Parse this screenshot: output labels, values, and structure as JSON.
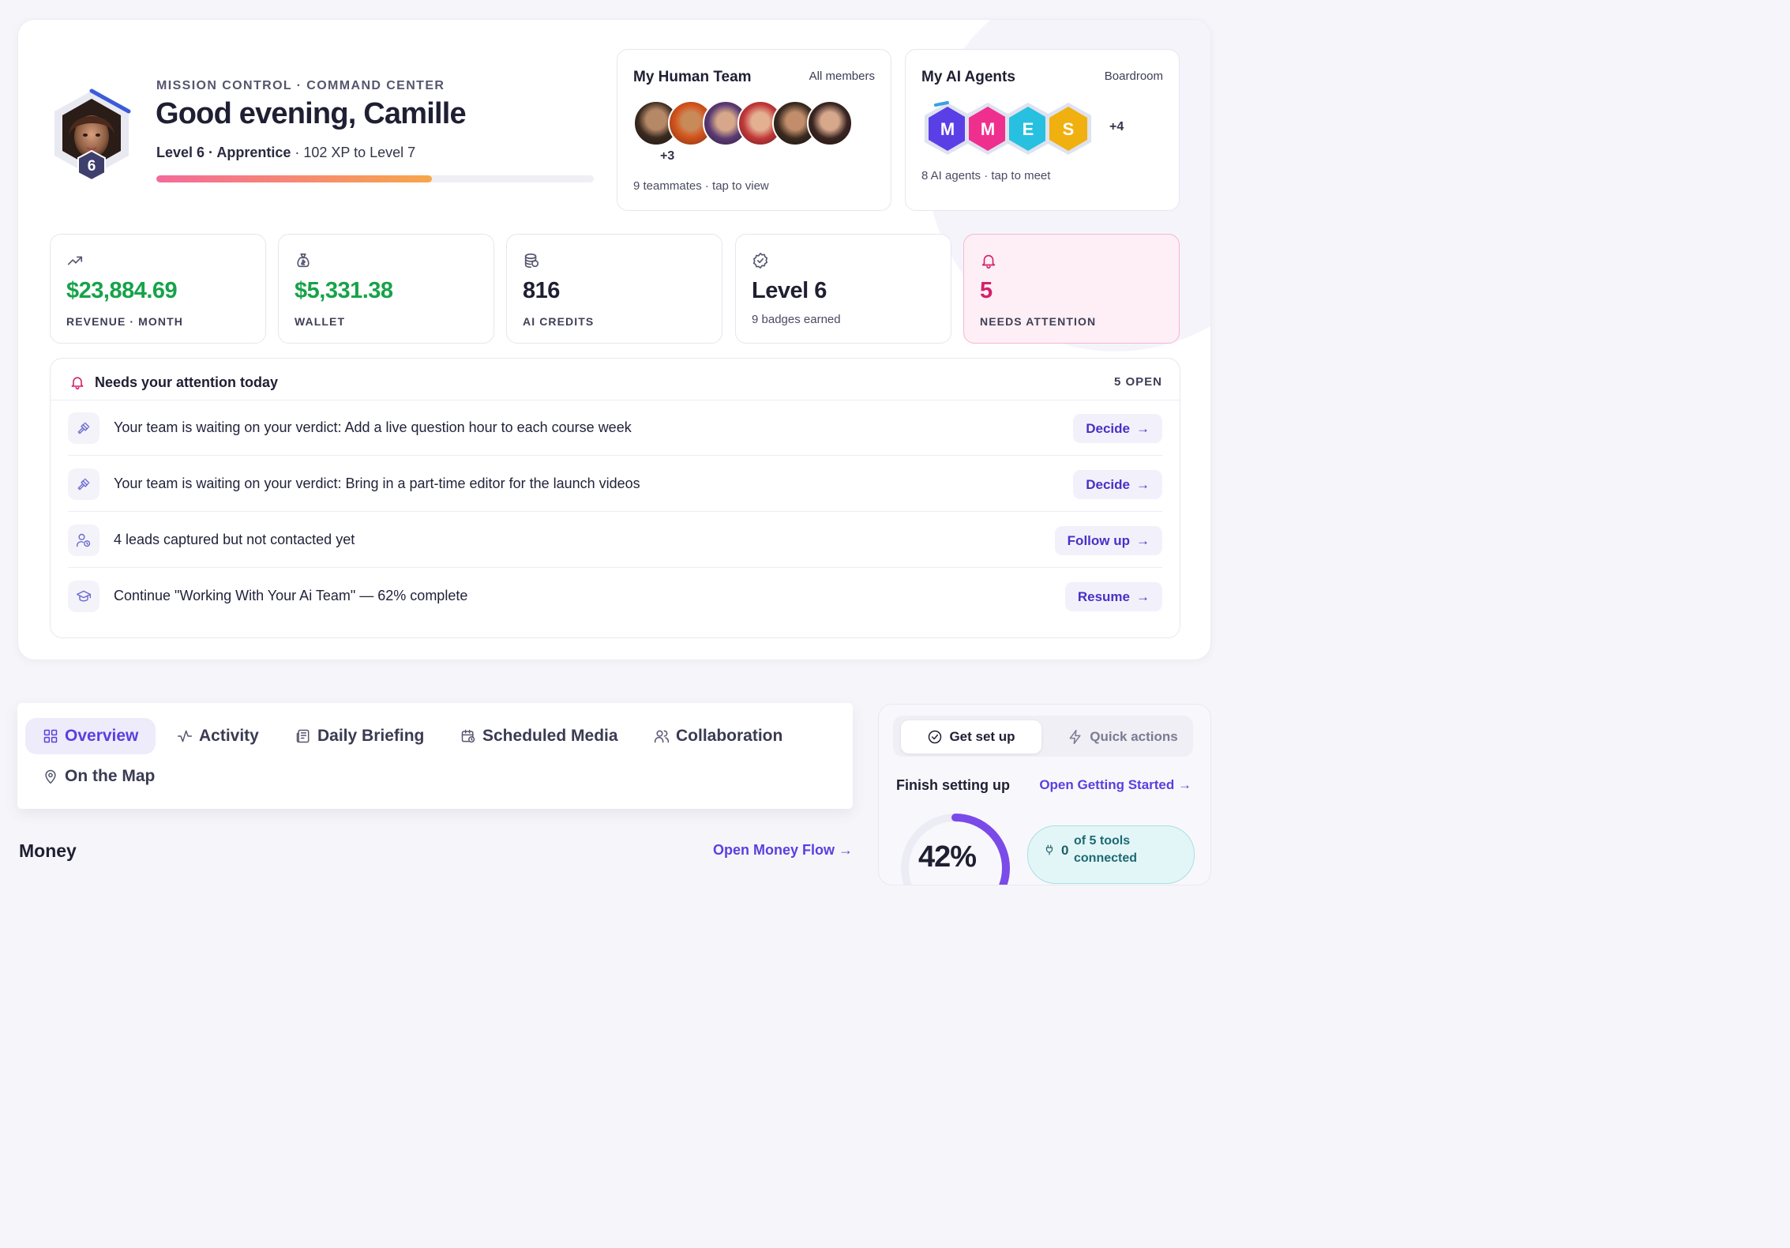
{
  "header": {
    "eyebrow": "MISSION CONTROL · COMMAND CENTER",
    "greeting": "Good evening, Camille",
    "level_badge": "6",
    "level_label": "Level 6 · Apprentice",
    "xp_text": " · 102 XP to Level 7",
    "xp_progress": 0.63
  },
  "human_team": {
    "title": "My Human Team",
    "link": "All members",
    "extra": "+3",
    "footer": "9 teammates · tap to view"
  },
  "ai_agents": {
    "title": "My AI Agents",
    "link": "Boardroom",
    "agents": [
      "M",
      "M",
      "E",
      "S"
    ],
    "extra": "+4",
    "footer": "8 AI agents · tap to meet"
  },
  "stats": [
    {
      "icon": "trending-up-icon",
      "value": "$23,884.69",
      "label": "REVENUE · MONTH"
    },
    {
      "icon": "money-bag-icon",
      "value": "$5,331.38",
      "label": "WALLET"
    },
    {
      "icon": "coins-icon",
      "value": "816",
      "label": "AI CREDITS"
    },
    {
      "icon": "badge-check-icon",
      "value": "Level 6",
      "label": "9 badges earned"
    },
    {
      "icon": "bell-icon",
      "value": "5",
      "label": "NEEDS ATTENTION"
    }
  ],
  "attention": {
    "title": "Needs your attention today",
    "count": "5 OPEN",
    "items": [
      {
        "icon": "gavel-icon",
        "text": "Your team is waiting on your verdict: Add a live question hour to each course week",
        "action": "Decide"
      },
      {
        "icon": "gavel-icon",
        "text": "Your team is waiting on your verdict: Bring in a part-time editor for the launch videos",
        "action": "Decide"
      },
      {
        "icon": "user-clock-icon",
        "text": "4 leads captured but not contacted yet",
        "action": "Follow up"
      },
      {
        "icon": "graduation-cap-icon",
        "text": "Continue \"Working With Your Ai Team\" — 62% complete",
        "action": "Resume"
      }
    ]
  },
  "tabs": [
    {
      "label": "Overview",
      "icon": "grid-icon"
    },
    {
      "label": "Activity",
      "icon": "activity-icon"
    },
    {
      "label": "Daily Briefing",
      "icon": "newspaper-icon"
    },
    {
      "label": "Scheduled Media",
      "icon": "calendar-clock-icon"
    },
    {
      "label": "Collaboration",
      "icon": "users-icon"
    },
    {
      "label": "On the Map",
      "icon": "map-pin-icon"
    }
  ],
  "money": {
    "title": "Money",
    "link": "Open Money Flow →"
  },
  "setup": {
    "seg_active": "Get set up",
    "seg_inactive": "Quick actions",
    "title": "Finish setting up",
    "link": "Open Getting Started →",
    "progress": "42%",
    "progress_value": 0.42,
    "tools_count": "0",
    "tools_text": "of 5 tools connected"
  },
  "colors": {
    "accent": "#5a3fe0",
    "money_green": "#16a34a",
    "attention_pink": "#d61f69",
    "agent_m1": "#5b3fe6",
    "agent_m2": "#ef2f8e",
    "agent_e": "#27c0e0",
    "agent_s": "#f0b010"
  }
}
